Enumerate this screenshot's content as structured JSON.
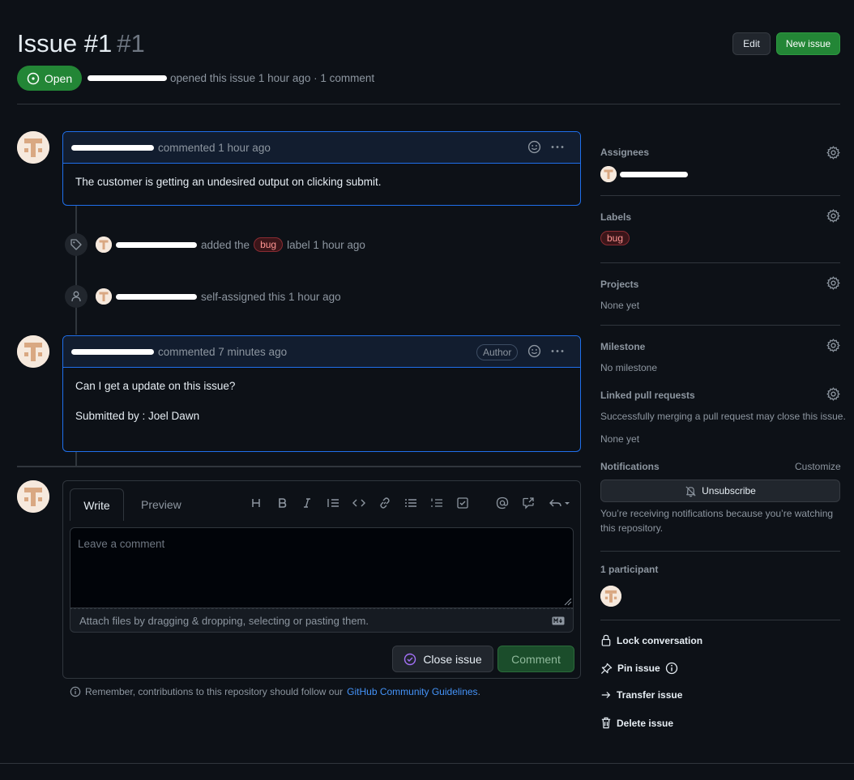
{
  "header": {
    "title": "Issue #1",
    "number": "#1",
    "edit_label": "Edit",
    "new_issue_label": "New issue",
    "state_label": "Open",
    "meta_text": "opened this issue 1 hour ago · 1 comment"
  },
  "comments": [
    {
      "meta": "commented 1 hour ago",
      "body": "The customer is getting an undesired output on clicking submit."
    },
    {
      "meta": "commented 7 minutes ago",
      "badge": "Author",
      "body_lines": [
        "Can I get a update on this issue?",
        "Submitted by : Joel Dawn"
      ]
    }
  ],
  "events": [
    {
      "before": "added the",
      "label": "bug",
      "after": "label 1 hour ago"
    },
    {
      "text": "self-assigned this 1 hour ago"
    }
  ],
  "editor": {
    "tab_write": "Write",
    "tab_preview": "Preview",
    "placeholder": "Leave a comment",
    "attach_text": "Attach files by dragging & dropping, selecting or pasting them.",
    "close_label": "Close issue",
    "comment_label": "Comment",
    "note_prefix": "Remember, contributions to this repository should follow our",
    "note_link": "GitHub Community Guidelines",
    "note_suffix": "."
  },
  "sidebar": {
    "assignees_label": "Assignees",
    "labels_label": "Labels",
    "label_bug": "bug",
    "projects_label": "Projects",
    "projects_value": "None yet",
    "milestone_label": "Milestone",
    "milestone_value": "No milestone",
    "linked_label": "Linked pull requests",
    "linked_desc": "Successfully merging a pull request may close this issue.",
    "linked_value": "None yet",
    "notifications_label": "Notifications",
    "customize_label": "Customize",
    "unsubscribe_label": "Unsubscribe",
    "notif_reason_1": "You’re receiving notifications because you’re watching",
    "notif_reason_2": "this repository.",
    "participants_label": "1 participant",
    "lock_label": "Lock conversation",
    "pin_label": "Pin issue",
    "transfer_label": "Transfer issue",
    "delete_label": "Delete issue"
  },
  "colors": {
    "open_green": "#238636",
    "comment_border": "#1f6feb",
    "link_blue": "#4493f8",
    "bug_label": "#ff9492"
  }
}
